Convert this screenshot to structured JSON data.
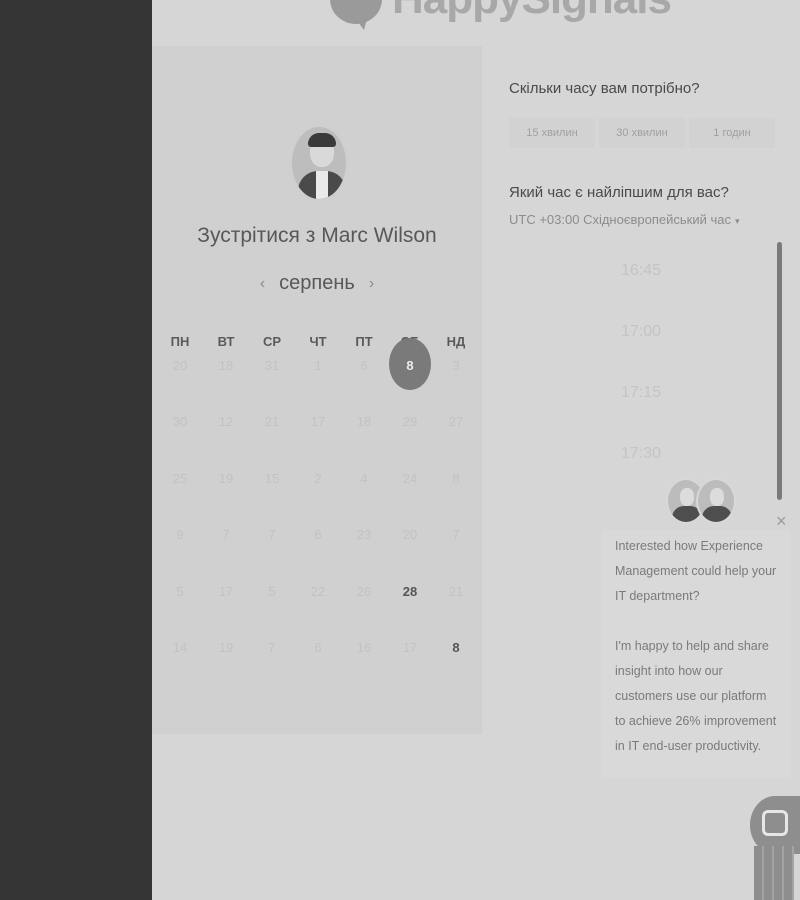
{
  "header": {
    "logo_text": "HappySignals"
  },
  "calendar": {
    "title_prefix": "Зустрітися з",
    "host_name": "Marc Wilson",
    "month": "серпень",
    "prev_arrow": "‹",
    "next_arrow": "›",
    "weekdays": [
      "ПН",
      "ВТ",
      "СР",
      "ЧТ",
      "ПТ",
      "СБ",
      "НД"
    ],
    "weeks": [
      [
        {
          "d": "20"
        },
        {
          "d": "18"
        },
        {
          "d": "31"
        },
        {
          "d": "1"
        },
        {
          "d": "6"
        },
        {
          "d": "8",
          "state": "selected"
        },
        {
          "d": "3"
        }
      ],
      [
        {
          "d": "30"
        },
        {
          "d": "12"
        },
        {
          "d": "21"
        },
        {
          "d": "17"
        },
        {
          "d": "18"
        },
        {
          "d": "29"
        },
        {
          "d": "27"
        }
      ],
      [
        {
          "d": "25"
        },
        {
          "d": "19"
        },
        {
          "d": "15"
        },
        {
          "d": "2"
        },
        {
          "d": "4"
        },
        {
          "d": "24"
        },
        {
          "d": "8"
        }
      ],
      [
        {
          "d": "9"
        },
        {
          "d": "7"
        },
        {
          "d": "7"
        },
        {
          "d": "6"
        },
        {
          "d": "23"
        },
        {
          "d": "20"
        },
        {
          "d": "7"
        }
      ],
      [
        {
          "d": "5"
        },
        {
          "d": "17"
        },
        {
          "d": "5"
        },
        {
          "d": "22"
        },
        {
          "d": "26"
        },
        {
          "d": "28",
          "state": "avail"
        },
        {
          "d": "21"
        }
      ],
      [
        {
          "d": "14"
        },
        {
          "d": "19"
        },
        {
          "d": "7"
        },
        {
          "d": "6"
        },
        {
          "d": "16"
        },
        {
          "d": "17"
        },
        {
          "d": "8",
          "state": "avail"
        }
      ]
    ]
  },
  "scheduler": {
    "duration_title": "Скільки часу вам потрібно?",
    "durations": [
      "15 хвилин",
      "30 хвилин",
      "1 годин"
    ],
    "time_title": "Який час є найліпшим для вас?",
    "timezone": "UTC +03:00 Східноєвропейський час",
    "tz_caret": "▾",
    "slots": [
      "16:45",
      "17:00",
      "17:15",
      "17:30"
    ]
  },
  "chat": {
    "close": "×",
    "message_1": "Interested how Experience Management could help your IT department?",
    "message_2": "I'm happy to help and share insight into how our customers use our platform to achieve 26% improvement in IT end-user productivity."
  }
}
